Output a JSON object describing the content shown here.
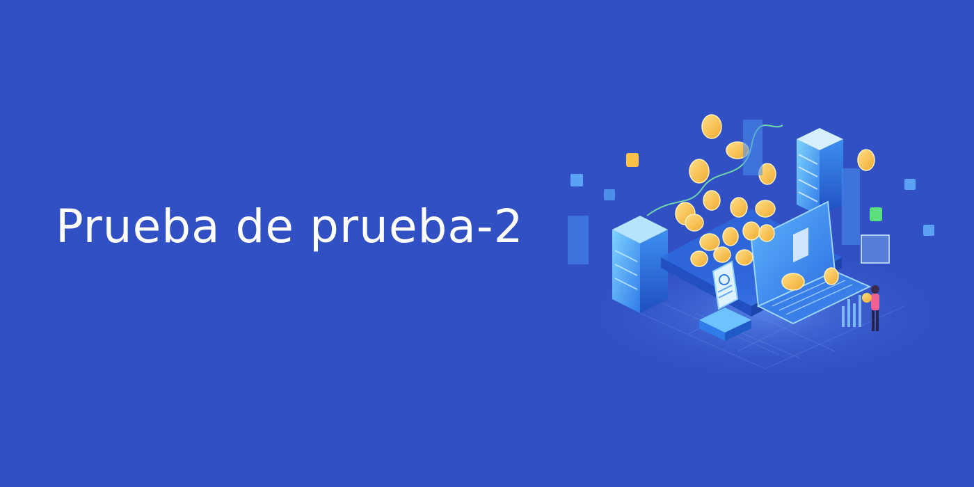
{
  "banner": {
    "title": "Prueba de prueba-2",
    "background_color": "#3150C4",
    "illustration": "isometric-digital-finance-illustration"
  }
}
